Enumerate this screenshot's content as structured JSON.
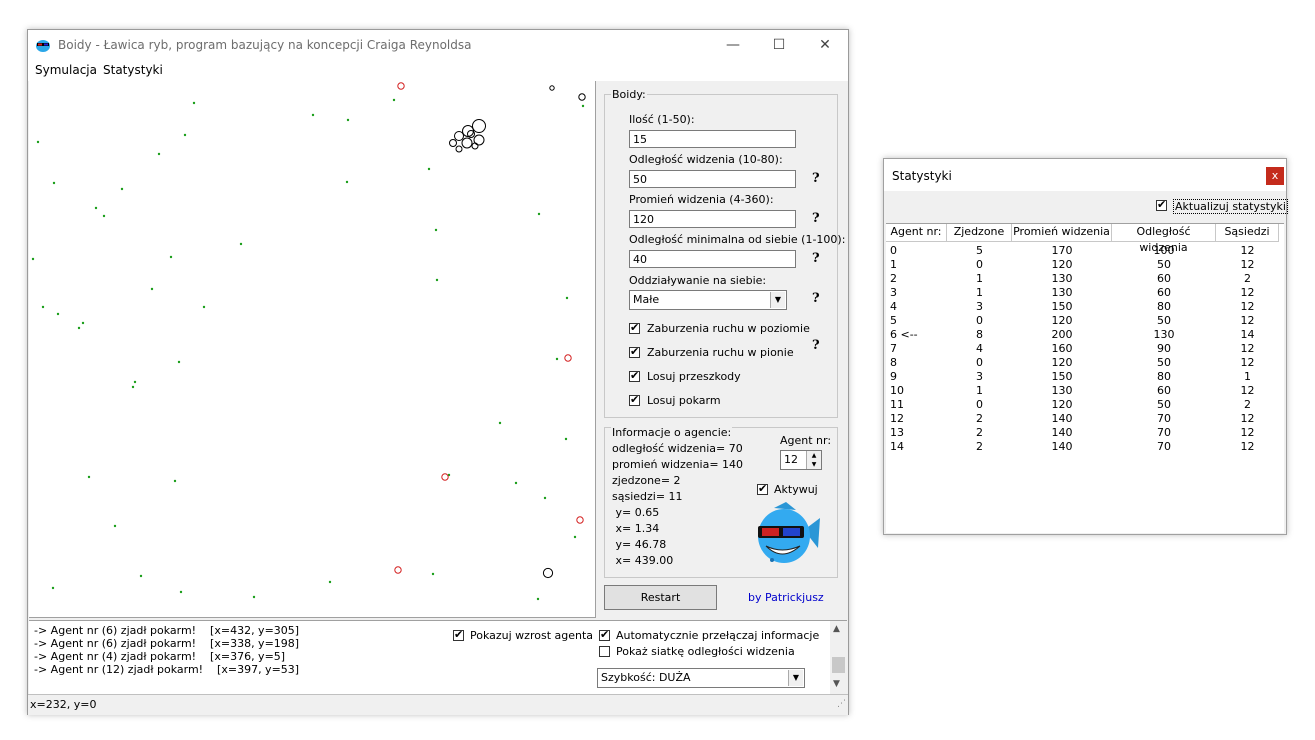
{
  "main_window": {
    "title": "Boidy - Ławica ryb, program bazujący na koncepcji Craiga Reynoldsa",
    "menu": [
      "Symulacja",
      "Statystyki"
    ],
    "boidy_group": {
      "label": "Boidy:",
      "ilosc_label": "Ilość (1-50):",
      "ilosc_value": "15",
      "odleglosc_label": "Odległość widzenia (10-80):",
      "odleglosc_value": "50",
      "promien_label": "Promień widzenia (4-360):",
      "promien_value": "120",
      "minimalna_label": "Odległość minimalna od siebie (1-100):",
      "minimalna_value": "40",
      "oddzialywanie_label": "Oddziaływanie na siebie:",
      "oddzialywanie_value": "Małe",
      "help": "?",
      "checks": [
        {
          "label": "Zaburzenia ruchu w poziomie",
          "checked": true
        },
        {
          "label": "Zaburzenia ruchu w pionie",
          "checked": true
        },
        {
          "label": "Losuj przeszkody",
          "checked": true
        },
        {
          "label": "Losuj pokarm",
          "checked": true
        }
      ]
    },
    "agent_group": {
      "label": "Informacje o agencie:",
      "lines": [
        "odległość widzenia= 70",
        "promień widzenia= 140",
        "zjedzone= 2",
        "sąsiedzi= 11",
        " y= 0.65",
        " x= 1.34",
        " y= 46.78",
        " x= 439.00"
      ],
      "agent_nr_label": "Agent nr:",
      "agent_nr_value": "12",
      "aktywuj_label": "Aktywuj",
      "aktywuj_checked": true
    },
    "restart_label": "Restart",
    "author": "by Patrickjusz",
    "log_lines": [
      "-> Agent nr (6) zjadł pokarm!    [x=432, y=305]",
      "-> Agent nr (6) zjadł pokarm!    [x=338, y=198]",
      "-> Agent nr (4) zjadł pokarm!    [x=376, y=5]",
      "-> Agent nr (12) zjadł pokarm!    [x=397, y=53]"
    ],
    "pokazuj_wzrost": {
      "label": "Pokazuj wzrost agenta",
      "checked": true
    },
    "auto_przelaczaj": {
      "label": "Automatycznie przełączaj informacje",
      "checked": true
    },
    "pokaz_siatke": {
      "label": "Pokaż siatkę odległości widzenia",
      "checked": false
    },
    "szybkosc_value": "Szybkość: DUŻA",
    "status_text": "x=232, y=0",
    "colors": {
      "food": "#1a9e1a",
      "obstacle": "#d42020",
      "boid": "#000000",
      "author_link": "#0000cc"
    }
  },
  "stats_window": {
    "title": "Statystyki",
    "close": "x",
    "aktualizuj_label": "Aktualizuj statystyki",
    "aktualizuj_checked": true,
    "columns": [
      "Agent nr:",
      "Zjedzone",
      "Promień widzenia",
      "Odległość widzenia",
      "Sąsiedzi"
    ],
    "rows": [
      [
        "0",
        "5",
        "170",
        "100",
        "12"
      ],
      [
        "1",
        "0",
        "120",
        "50",
        "12"
      ],
      [
        "2",
        "1",
        "130",
        "60",
        "2"
      ],
      [
        "3",
        "1",
        "130",
        "60",
        "12"
      ],
      [
        "4",
        "3",
        "150",
        "80",
        "12"
      ],
      [
        "5",
        "0",
        "120",
        "50",
        "12"
      ],
      [
        "6 <--",
        "8",
        "200",
        "130",
        "14"
      ],
      [
        "7",
        "4",
        "160",
        "90",
        "12"
      ],
      [
        "8",
        "0",
        "120",
        "50",
        "12"
      ],
      [
        "9",
        "3",
        "150",
        "80",
        "1"
      ],
      [
        "10",
        "1",
        "130",
        "60",
        "12"
      ],
      [
        "11",
        "0",
        "120",
        "50",
        "2"
      ],
      [
        "12",
        "2",
        "140",
        "70",
        "12"
      ],
      [
        "13",
        "2",
        "140",
        "70",
        "12"
      ],
      [
        "14",
        "2",
        "140",
        "70",
        "12"
      ]
    ]
  }
}
